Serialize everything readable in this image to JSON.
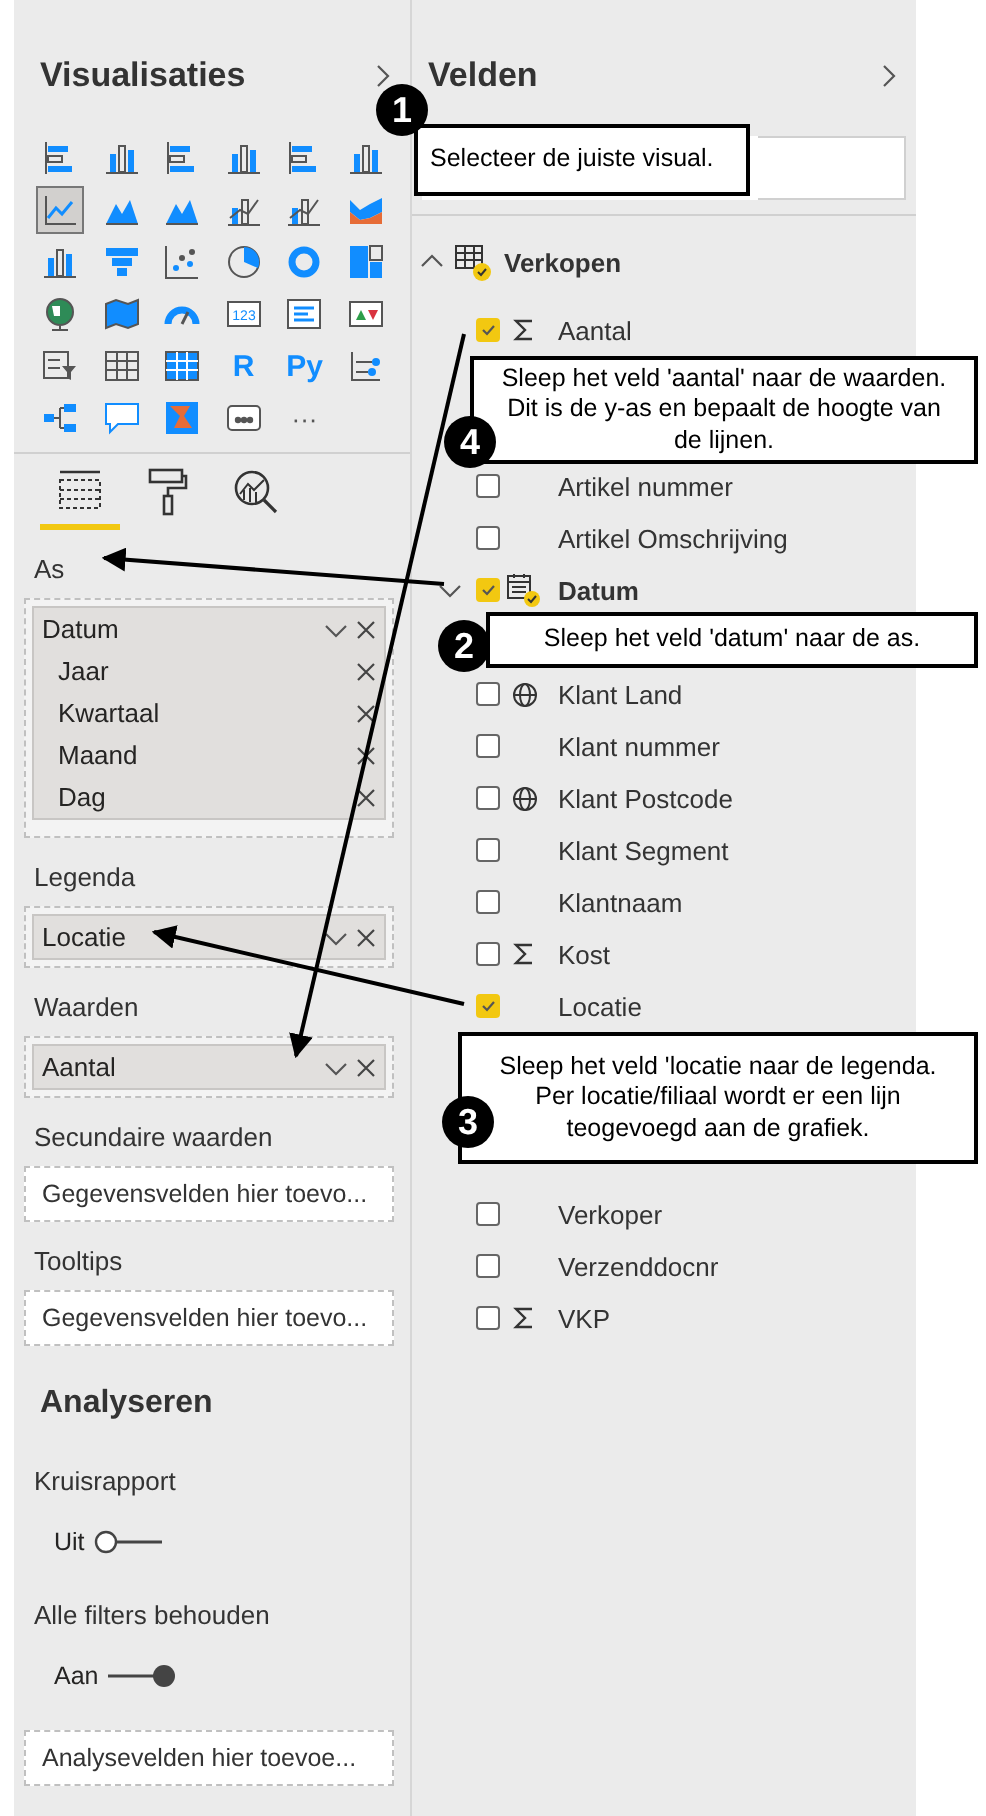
{
  "visualizations": {
    "title": "Visualisaties",
    "types": [
      {
        "kind": "hbar",
        "selected": false
      },
      {
        "kind": "column",
        "selected": false
      },
      {
        "kind": "hbar",
        "selected": false
      },
      {
        "kind": "column",
        "selected": false
      },
      {
        "kind": "hbar",
        "selected": false
      },
      {
        "kind": "column",
        "selected": false
      },
      {
        "kind": "line",
        "selected": true
      },
      {
        "kind": "area",
        "selected": false
      },
      {
        "kind": "area",
        "selected": false
      },
      {
        "kind": "combo",
        "selected": false
      },
      {
        "kind": "combo",
        "selected": false
      },
      {
        "kind": "ribbon",
        "selected": false
      },
      {
        "kind": "column",
        "selected": false
      },
      {
        "kind": "funnel",
        "selected": false
      },
      {
        "kind": "scatter",
        "selected": false
      },
      {
        "kind": "pie",
        "selected": false
      },
      {
        "kind": "donut",
        "selected": false
      },
      {
        "kind": "treemap",
        "selected": false
      },
      {
        "kind": "globe",
        "selected": false
      },
      {
        "kind": "map",
        "selected": false
      },
      {
        "kind": "gauge",
        "selected": false
      },
      {
        "kind": "card",
        "label": "123",
        "selected": false
      },
      {
        "kind": "multicard",
        "selected": false
      },
      {
        "kind": "kpi",
        "selected": false
      },
      {
        "kind": "slicer",
        "selected": false
      },
      {
        "kind": "table",
        "selected": false
      },
      {
        "kind": "matrix",
        "selected": false
      },
      {
        "kind": "text",
        "label": "R",
        "selected": false
      },
      {
        "kind": "text",
        "label": "Py",
        "selected": false
      },
      {
        "kind": "influencers",
        "selected": false
      },
      {
        "kind": "tree",
        "selected": false
      },
      {
        "kind": "bubble",
        "selected": false
      },
      {
        "kind": "narrative",
        "selected": false
      },
      {
        "kind": "apps",
        "selected": false
      },
      {
        "kind": "more",
        "label": "···",
        "selected": false
      }
    ]
  },
  "pane_tabs": [
    {
      "kind": "fields",
      "selected": true
    },
    {
      "kind": "format",
      "selected": false
    },
    {
      "kind": "analytics",
      "selected": false
    }
  ],
  "wells": [
    {
      "label": "As",
      "fields": [
        {
          "name": "Datum",
          "children": [
            {
              "name": "Jaar"
            },
            {
              "name": "Kwartaal"
            },
            {
              "name": "Maand"
            },
            {
              "name": "Dag"
            }
          ]
        }
      ]
    },
    {
      "label": "Legenda",
      "fields": [
        {
          "name": "Locatie"
        }
      ]
    },
    {
      "label": "Waarden",
      "fields": [
        {
          "name": "Aantal"
        }
      ]
    },
    {
      "label": "Secundaire waarden",
      "placeholder": "Gegevensvelden hier toevo..."
    },
    {
      "label": "Tooltips",
      "placeholder": "Gegevensvelden hier toevo..."
    }
  ],
  "analytics": {
    "title": "Analyseren",
    "toggles": [
      {
        "label": "Kruisrapport",
        "state": "Uit",
        "on": false
      },
      {
        "label": "Alle filters behouden",
        "state": "Aan",
        "on": true
      }
    ],
    "placeholder": "Analysevelden hier toevoe..."
  },
  "fields_pane": {
    "title": "Velden",
    "tables": [
      {
        "name": "Verkopen",
        "expanded": true,
        "children": [
          {
            "kind": "measure",
            "name": "Aantal",
            "checked": true
          },
          {
            "kind": "field",
            "name": "Artikel nummer",
            "checked": false
          },
          {
            "kind": "field",
            "name": "Artikel Omschrijving",
            "checked": false
          },
          {
            "kind": "hierarchy",
            "name": "Datum",
            "checked": true,
            "expanded": false
          },
          {
            "kind": "geo",
            "name": "Klant Land",
            "checked": false
          },
          {
            "kind": "field",
            "name": "Klant nummer",
            "checked": false
          },
          {
            "kind": "geo",
            "name": "Klant Postcode",
            "checked": false
          },
          {
            "kind": "field",
            "name": "Klant Segment",
            "checked": false
          },
          {
            "kind": "field",
            "name": "Klantnaam",
            "checked": false
          },
          {
            "kind": "measure",
            "name": "Kost",
            "checked": false
          },
          {
            "kind": "field",
            "name": "Locatie",
            "checked": true
          },
          {
            "kind": "field",
            "name": "Verkoper",
            "checked": false
          },
          {
            "kind": "field",
            "name": "Verzenddocnr",
            "checked": false
          },
          {
            "kind": "measure",
            "name": "VKP",
            "checked": false
          }
        ]
      }
    ]
  },
  "callouts": [
    {
      "number": "1",
      "lines": [
        "Selecteer de juiste visual."
      ]
    },
    {
      "number": "4",
      "lines": [
        "Sleep het veld 'aantal' naar de waarden.",
        "Dit is de y-as en bepaalt de hoogte van",
        "de lijnen."
      ]
    },
    {
      "number": "2",
      "lines": [
        "Sleep het veld 'datum' naar de as."
      ]
    },
    {
      "number": "3",
      "lines": [
        "Sleep het veld 'locatie naar de legenda.",
        "Per locatie/filiaal wordt er een lijn",
        "teogevoegd aan de grafiek."
      ]
    }
  ]
}
